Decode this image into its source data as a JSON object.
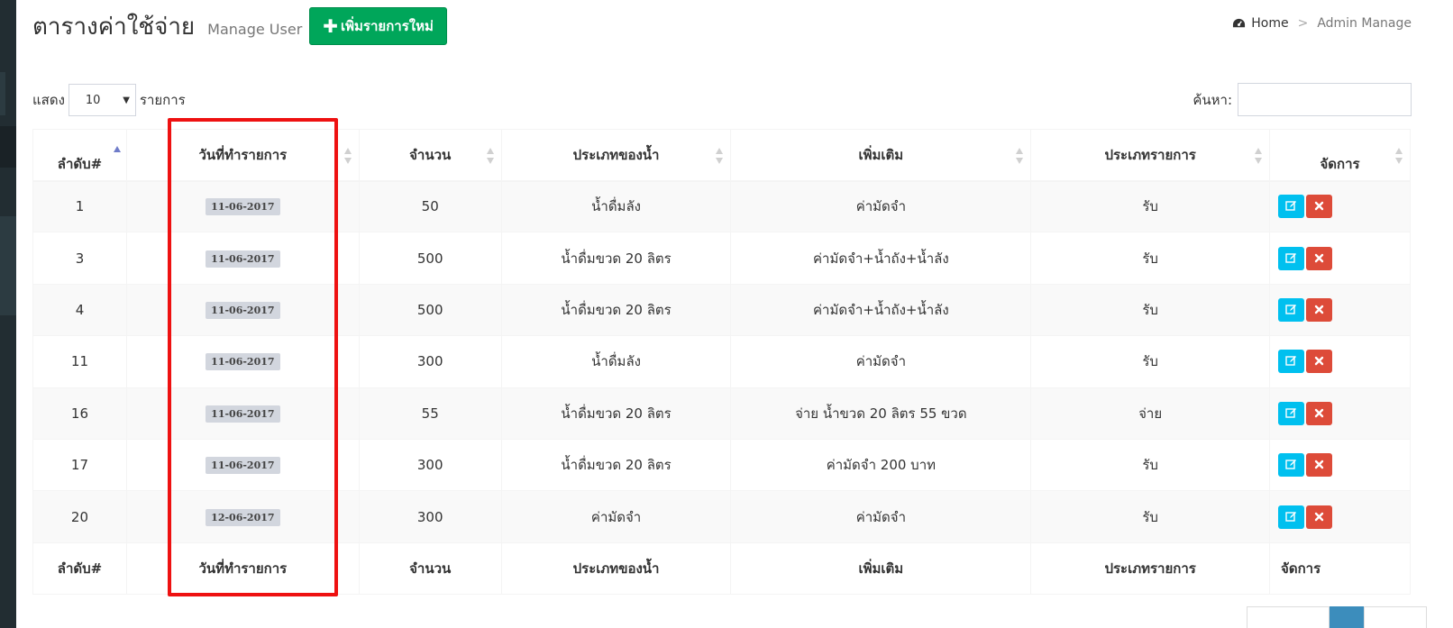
{
  "header": {
    "title": "ตารางค่าใช้จ่าย",
    "subtitle": "Manage User",
    "add_button": "เพิ่มรายการใหม่"
  },
  "breadcrumb": {
    "home": "Home",
    "separator": ">",
    "active": "Admin Manage"
  },
  "length_control": {
    "prefix": "แสดง",
    "selected": "10",
    "suffix": "รายการ"
  },
  "search": {
    "label": "ค้นหา:",
    "value": ""
  },
  "table": {
    "columns": [
      "ลำดับ#",
      "วันที่ทำรายการ",
      "จำนวน",
      "ประเภทของน้ำ",
      "เพิ่มเติม",
      "ประเภทรายการ",
      "จัดการ"
    ],
    "rows": [
      {
        "id": "1",
        "date": "11-06-2017",
        "amount": "50",
        "water_type": "น้ำดื่มลัง",
        "note": "ค่ามัดจำ",
        "kind": "รับ"
      },
      {
        "id": "3",
        "date": "11-06-2017",
        "amount": "500",
        "water_type": "น้ำดื่มขวด 20 ลิตร",
        "note": "ค่ามัดจำ+น้ำถัง+น้ำลัง",
        "kind": "รับ"
      },
      {
        "id": "4",
        "date": "11-06-2017",
        "amount": "500",
        "water_type": "น้ำดื่มขวด 20 ลิตร",
        "note": "ค่ามัดจำ+น้ำถัง+น้ำลัง",
        "kind": "รับ"
      },
      {
        "id": "11",
        "date": "11-06-2017",
        "amount": "300",
        "water_type": "น้ำดื่มลัง",
        "note": "ค่ามัดจำ",
        "kind": "รับ"
      },
      {
        "id": "16",
        "date": "11-06-2017",
        "amount": "55",
        "water_type": "น้ำดื่มขวด 20 ลิตร",
        "note": "จ่าย น้ำขวด 20 ลิตร 55 ขวด",
        "kind": "จ่าย"
      },
      {
        "id": "17",
        "date": "11-06-2017",
        "amount": "300",
        "water_type": "น้ำดื่มขวด 20 ลิตร",
        "note": "ค่ามัดจำ 200 บาท",
        "kind": "รับ"
      },
      {
        "id": "20",
        "date": "12-06-2017",
        "amount": "300",
        "water_type": "ค่ามัดจำ",
        "note": "ค่ามัดจำ",
        "kind": "รับ"
      }
    ]
  },
  "colors": {
    "add_button": "#00a65a",
    "edit_button": "#00c0ef",
    "delete_button": "#dd4b39",
    "highlight_box": "#ee1111",
    "date_badge": "#d2d6de"
  },
  "icons": {
    "breadcrumb": "dashboard-icon",
    "add": "plus-icon",
    "edit": "edit-icon",
    "delete": "close-icon"
  }
}
